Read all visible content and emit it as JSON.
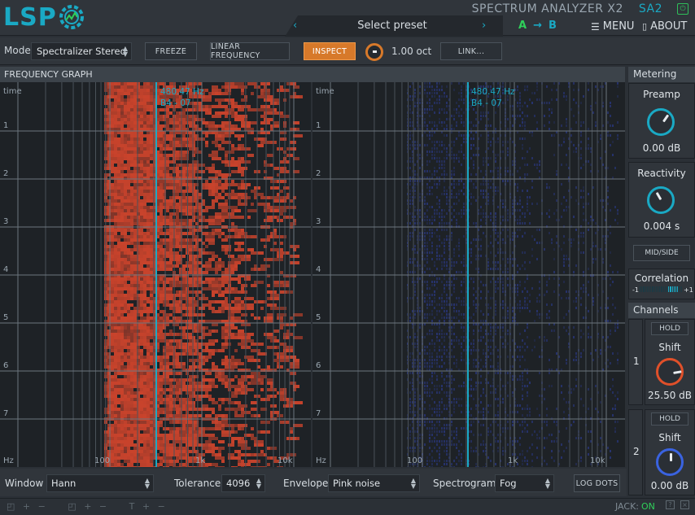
{
  "header": {
    "logo": "LSP",
    "product_title": "SPECTRUM ANALYZER X2",
    "product_short": "SA2",
    "preset_prev": "‹",
    "preset_label": "Select preset",
    "preset_next": "›",
    "ab_a": "A",
    "ab_arrow": "→",
    "ab_b": "B",
    "menu_label": "MENU",
    "about_label": "ABOUT"
  },
  "toolbar": {
    "mode_label": "Mode",
    "mode_value": "Spectralizer Stereo",
    "freeze_label": "FREEZE",
    "linear_frequency_label": "LINEAR FREQUENCY",
    "inspect_label": "INSPECT",
    "inspect_range_value": "1.00 oct",
    "link_label": "LINK..."
  },
  "graph": {
    "title": "FREQUENCY GRAPH",
    "time_label": "time",
    "time_ticks": [
      "1",
      "2",
      "3",
      "4",
      "5",
      "6",
      "7"
    ],
    "hz_label": "Hz",
    "freq_ticks": [
      "100",
      "1k",
      "10k"
    ],
    "left": {
      "cursor_freq": "480.47 Hz",
      "cursor_note": "B4 - 07"
    },
    "right": {
      "cursor_freq": "480.47 Hz",
      "cursor_note": "B4 - 07"
    }
  },
  "bottom": {
    "window_label": "Window",
    "window_value": "Hann",
    "tolerance_label": "Tolerance",
    "tolerance_value": "4096",
    "envelope_label": "Envelope",
    "envelope_value": "Pink noise",
    "spectrogram_label": "Spectrogram",
    "spectrogram_value": "Fog",
    "log_dots_label": "LOG DOTS"
  },
  "metering": {
    "title": "Metering",
    "preamp_label": "Preamp",
    "preamp_value": "0.00 dB",
    "reactivity_label": "Reactivity",
    "reactivity_value": "0.004 s",
    "midside_label": "MID/SIDE",
    "correlation_label": "Correlation",
    "corr_min": "-1",
    "corr_max": "+1"
  },
  "channels": {
    "title": "Channels",
    "items": [
      {
        "number": "1",
        "hold_label": "HOLD",
        "shift_label": "Shift",
        "shift_value": "25.50 dB",
        "color": "#e0502a"
      },
      {
        "number": "2",
        "hold_label": "HOLD",
        "shift_label": "Shift",
        "shift_value": "0.00 dB",
        "color": "#3a63e0"
      }
    ]
  },
  "status": {
    "jack_label": "JACK:",
    "jack_value": "ON",
    "help_icon": "?",
    "close_icon": "×"
  },
  "colors": {
    "accent": "#1aa9c4",
    "inspect_active": "#d7792a",
    "left_spectrum": "#c8432c",
    "right_spectrum": "#2b3a8c",
    "jack_on": "#2fcf5a"
  }
}
